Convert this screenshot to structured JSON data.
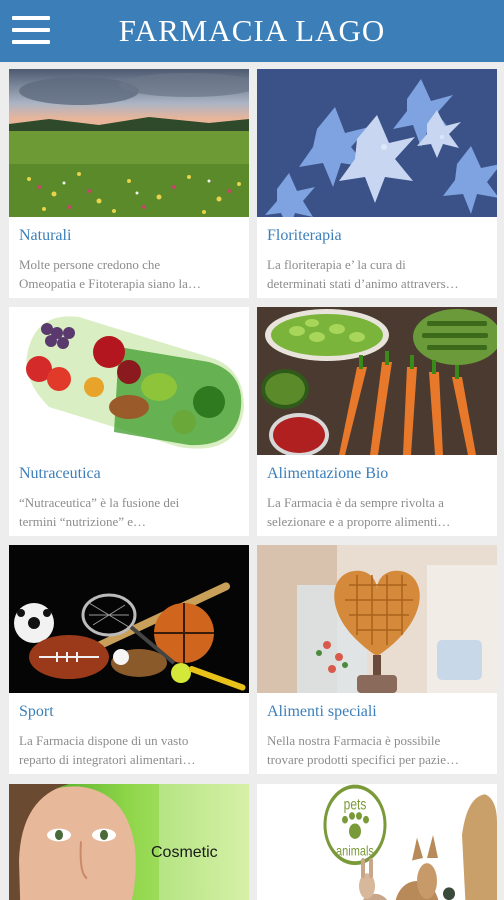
{
  "header": {
    "title": "FARMACIA LAGO"
  },
  "cards": [
    {
      "title": "Naturali",
      "desc1": "Molte persone credono che",
      "desc2": "Omeopatia e Fitoterapia siano la…"
    },
    {
      "title": "Floriterapia",
      "desc1": "La floriterapia e’ la cura di",
      "desc2": "determinati stati d’animo attravers…"
    },
    {
      "title": "Nutraceutica",
      "desc1": "“Nutraceutica” è la fusione dei",
      "desc2": "termini “nutrizione” e…"
    },
    {
      "title": "Alimentazione Bio",
      "desc1": "La Farmacia è da sempre rivolta a",
      "desc2": "selezionare e a proporre alimenti…"
    },
    {
      "title": "Sport",
      "desc1": "La Farmacia dispone di un vasto",
      "desc2": "reparto di integratori alimentari…"
    },
    {
      "title": "Alimenti speciali",
      "desc1": "Nella nostra Farmacia è possibile",
      "desc2": "trovare prodotti specifici per pazie…"
    },
    {
      "image_text": "Cosmetic"
    },
    {
      "image_text_1": "pets",
      "image_text_2": "animals"
    }
  ]
}
